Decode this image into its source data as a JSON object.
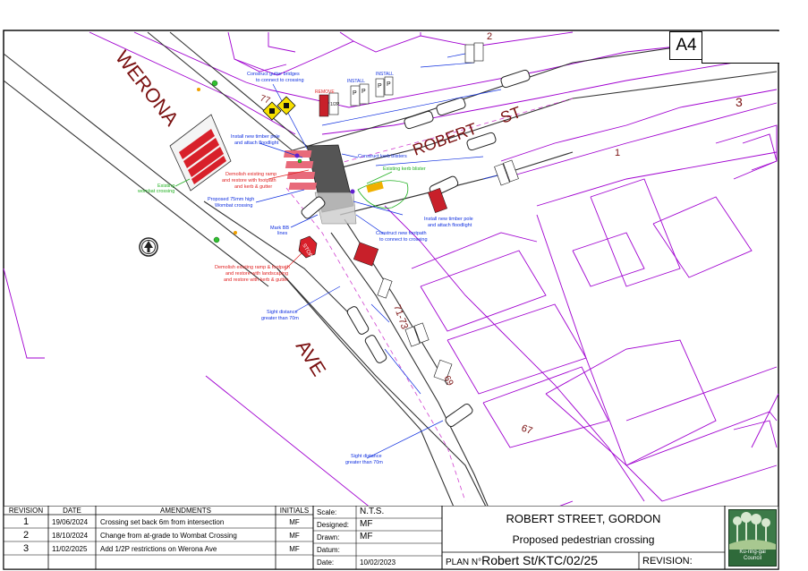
{
  "sheet": {
    "size": "A4"
  },
  "streets": {
    "werona": "WERONA",
    "ave": "AVE",
    "robert": "ROBERT",
    "st": "ST"
  },
  "lots": {
    "lot_2": "2",
    "lot_3": "3",
    "lot_1": "1",
    "lot_77": "77",
    "lot_71_73": "71-73",
    "lot_69": "69",
    "lot_67": "67"
  },
  "annotations": {
    "gutter_bridges": [
      "Construct gutter bridges",
      "to connect to crossing"
    ],
    "timber_pole_top": [
      "Install new timber pole",
      "and attach floodlight"
    ],
    "demolish_top": [
      "Demolish existing ramp",
      "and restore with footpath",
      "and kerb & gutter"
    ],
    "wombat_proposed": [
      "Proposed 75mm high",
      "Wombat crossing"
    ],
    "mark_bb": [
      "Mark BB",
      "lines"
    ],
    "existing_wombat": [
      "Existing",
      "wombat crossing"
    ],
    "kerb_blisters": "Construct kerb blisters",
    "existing_kerb_blister": "Existing kerb blister",
    "timber_pole_bottom": [
      "Install new timber pole",
      "and attach floodlight"
    ],
    "new_footpath": [
      "Construct new footpath",
      "to connect to crossing"
    ],
    "demolish_bottom": [
      "Demolish existing ramp & footpath",
      "and restore with landscaping",
      "and restore with kerb & gutter"
    ],
    "sight_top": [
      "Sight distance",
      "greater than 70m"
    ],
    "sight_bottom": [
      "Sight distance",
      "greater than 70m"
    ]
  },
  "signs": {
    "stop": "STOP",
    "remove": "REMOVE",
    "install": "INSTALL",
    "p": "P",
    "half_p": "1/2P"
  },
  "revisions": {
    "headers": [
      "REVISION",
      "DATE",
      "AMENDMENTS",
      "INITIALS"
    ],
    "rows": [
      [
        "1",
        "19/06/2024",
        "Crossing set back 6m from intersection",
        "MF"
      ],
      [
        "2",
        "18/10/2024",
        "Change from at-grade to Wombat Crossing",
        "MF"
      ],
      [
        "3",
        "11/02/2025",
        "Add 1/2P restrictions on Werona Ave",
        "MF"
      ]
    ]
  },
  "drawing_info": {
    "scale_label": "Scale:",
    "scale_value": "N.T.S.",
    "designed_label": "Designed:",
    "designed_value": "MF",
    "drawn_label": "Drawn:",
    "drawn_value": "MF",
    "datum_label": "Datum:",
    "datum_value": "",
    "date_label": "Date:",
    "date_value": "10/02/2023"
  },
  "title": {
    "line1": "ROBERT STREET, GORDON",
    "line2": "Proposed pedestrian crossing",
    "plan_label": "PLAN N°",
    "plan_number": "Robert St/KTC/02/25",
    "revision_label": "REVISION:"
  },
  "council": {
    "line1": "Ku-ring-gai",
    "line2": "Council"
  },
  "colors": {
    "property": "#a000d0",
    "road": "#222222",
    "annotation_blue": "#1030e0",
    "annotation_red": "#e02020",
    "annotation_green": "#20b020",
    "crossing_red": "#d8202a",
    "street_name": "#7a1010"
  }
}
